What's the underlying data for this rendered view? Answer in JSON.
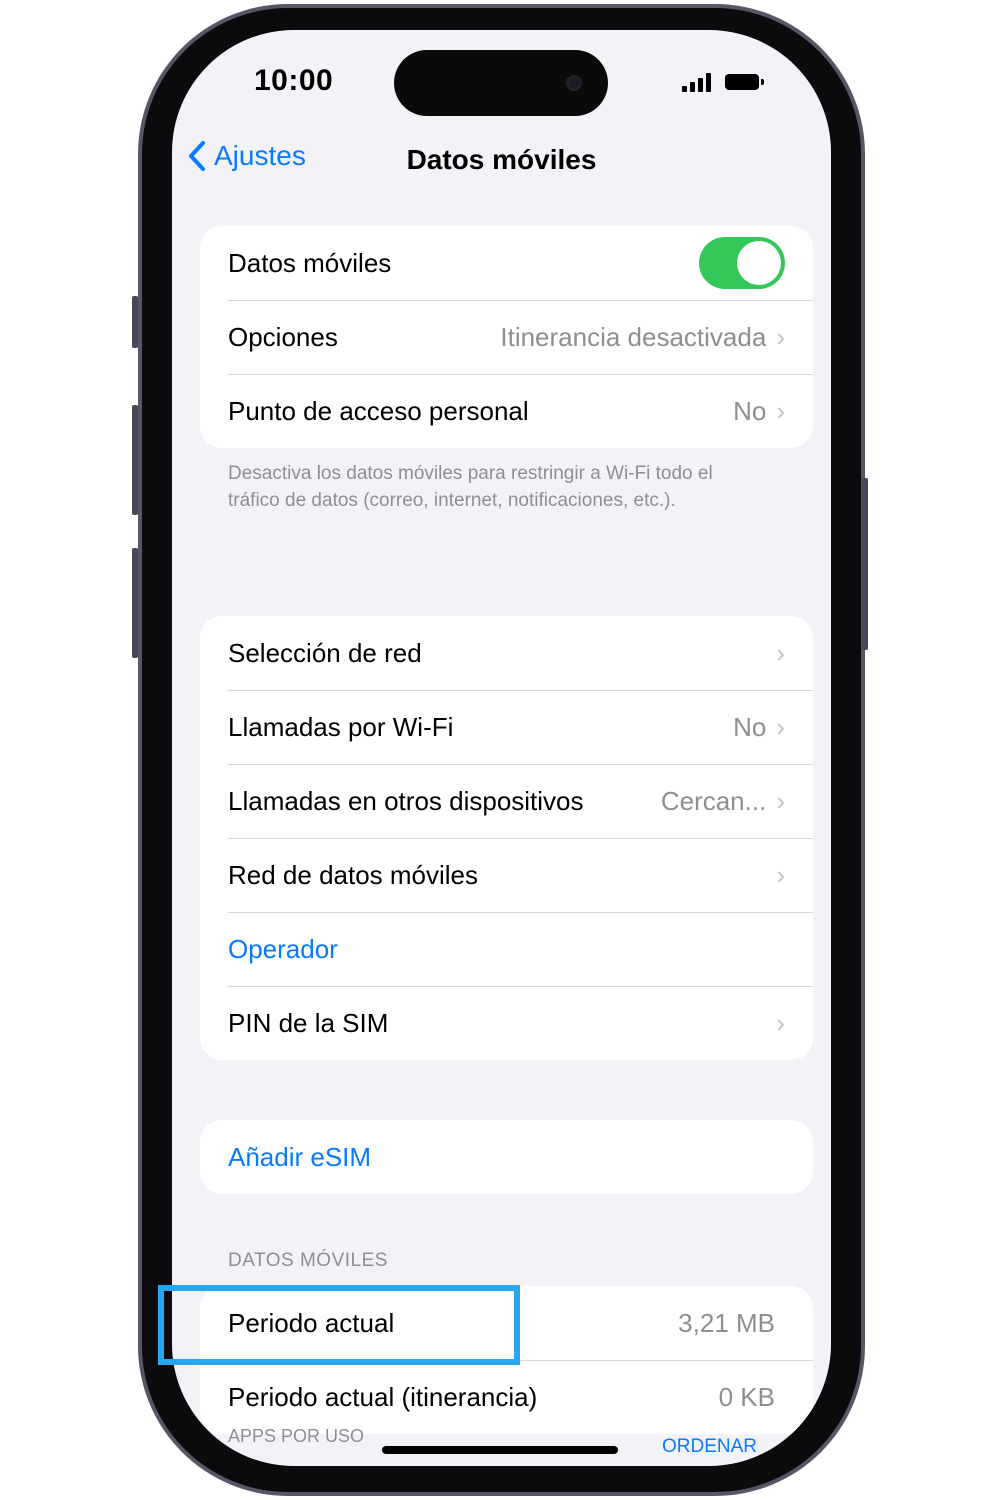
{
  "status_bar": {
    "time": "10:00"
  },
  "nav": {
    "back_label": "Ajustes",
    "title": "Datos móviles"
  },
  "group1": [
    {
      "label": "Datos móviles",
      "toggle": true
    },
    {
      "label": "Opciones",
      "value": "Itinerancia desactivada"
    },
    {
      "label": "Punto de acceso personal",
      "value": "No"
    }
  ],
  "footnote": "Desactiva los datos móviles para restringir a Wi-Fi todo el tráfico de datos (correo, internet, notificaciones, etc.).",
  "group2": [
    {
      "label": "Selección de red",
      "value": ""
    },
    {
      "label": "Llamadas por Wi-Fi",
      "value": "No"
    },
    {
      "label": "Llamadas en otros dispositivos",
      "value": "Cercan..."
    },
    {
      "label": "Red de datos móviles",
      "value": ""
    },
    {
      "label": "Operador"
    },
    {
      "label": "PIN de la SIM",
      "value": ""
    }
  ],
  "group3": {
    "add_esim": "Añadir eSIM"
  },
  "data_section": {
    "header": "DATOS MÓVILES",
    "rows": [
      {
        "label": "Periodo actual",
        "value": "3,21 MB"
      },
      {
        "label": "Periodo actual (itinerancia)",
        "value": "0 KB"
      }
    ],
    "sort_label": "APPS POR USO",
    "sort_action": "ORDENAR"
  },
  "colors": {
    "accent": "#0a7aff",
    "toggle_on": "#34c759",
    "highlight": "#29a6f0"
  }
}
